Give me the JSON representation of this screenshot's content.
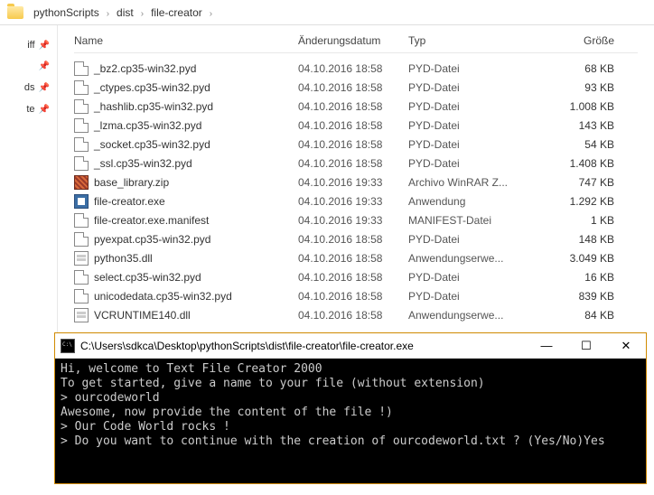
{
  "breadcrumb": [
    "pythonScripts",
    "dist",
    "file-creator"
  ],
  "sidebar": {
    "items": [
      {
        "label": "iff"
      },
      {
        "label": ""
      },
      {
        "label": "ds"
      },
      {
        "label": "te"
      }
    ]
  },
  "columns": {
    "name": "Name",
    "date": "Änderungsdatum",
    "type": "Typ",
    "size": "Größe"
  },
  "files": [
    {
      "name": "_bz2.cp35-win32.pyd",
      "date": "04.10.2016 18:58",
      "type": "PYD-Datei",
      "size": "68 KB",
      "ico": "file"
    },
    {
      "name": "_ctypes.cp35-win32.pyd",
      "date": "04.10.2016 18:58",
      "type": "PYD-Datei",
      "size": "93 KB",
      "ico": "file"
    },
    {
      "name": "_hashlib.cp35-win32.pyd",
      "date": "04.10.2016 18:58",
      "type": "PYD-Datei",
      "size": "1.008 KB",
      "ico": "file"
    },
    {
      "name": "_lzma.cp35-win32.pyd",
      "date": "04.10.2016 18:58",
      "type": "PYD-Datei",
      "size": "143 KB",
      "ico": "file"
    },
    {
      "name": "_socket.cp35-win32.pyd",
      "date": "04.10.2016 18:58",
      "type": "PYD-Datei",
      "size": "54 KB",
      "ico": "file"
    },
    {
      "name": "_ssl.cp35-win32.pyd",
      "date": "04.10.2016 18:58",
      "type": "PYD-Datei",
      "size": "1.408 KB",
      "ico": "file"
    },
    {
      "name": "base_library.zip",
      "date": "04.10.2016 19:33",
      "type": "Archivo WinRAR Z...",
      "size": "747 KB",
      "ico": "zip"
    },
    {
      "name": "file-creator.exe",
      "date": "04.10.2016 19:33",
      "type": "Anwendung",
      "size": "1.292 KB",
      "ico": "exe"
    },
    {
      "name": "file-creator.exe.manifest",
      "date": "04.10.2016 19:33",
      "type": "MANIFEST-Datei",
      "size": "1 KB",
      "ico": "file"
    },
    {
      "name": "pyexpat.cp35-win32.pyd",
      "date": "04.10.2016 18:58",
      "type": "PYD-Datei",
      "size": "148 KB",
      "ico": "file"
    },
    {
      "name": "python35.dll",
      "date": "04.10.2016 18:58",
      "type": "Anwendungserwe...",
      "size": "3.049 KB",
      "ico": "dll"
    },
    {
      "name": "select.cp35-win32.pyd",
      "date": "04.10.2016 18:58",
      "type": "PYD-Datei",
      "size": "16 KB",
      "ico": "file"
    },
    {
      "name": "unicodedata.cp35-win32.pyd",
      "date": "04.10.2016 18:58",
      "type": "PYD-Datei",
      "size": "839 KB",
      "ico": "file"
    },
    {
      "name": "VCRUNTIME140.dll",
      "date": "04.10.2016 18:58",
      "type": "Anwendungserwe...",
      "size": "84 KB",
      "ico": "dll"
    }
  ],
  "console": {
    "title": "C:\\Users\\sdkca\\Desktop\\pythonScripts\\dist\\file-creator\\file-creator.exe",
    "btn_min": "—",
    "btn_max": "☐",
    "btn_close": "✕",
    "lines": [
      "Hi, welcome to Text File Creator 2000",
      "To get started, give a name to your file (without extension)",
      "> ourcodeworld",
      "Awesome, now provide the content of the file !)",
      "> Our Code World rocks !",
      "> Do you want to continue with the creation of ourcodeworld.txt ? (Yes/No)Yes"
    ]
  }
}
